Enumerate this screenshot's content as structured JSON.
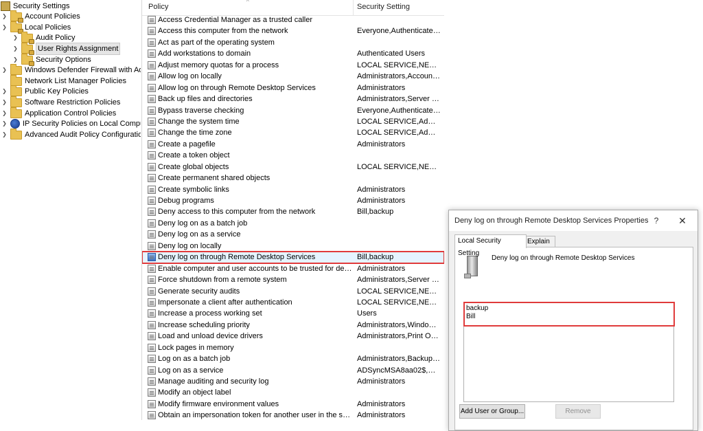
{
  "tree": {
    "items": [
      {
        "label": "Security Settings",
        "icon": "security-settings-icon"
      },
      {
        "label": "Account Policies",
        "icon": "folder-icon"
      },
      {
        "label": "Local Policies",
        "icon": "folder-icon"
      },
      {
        "label": "Audit Policy",
        "icon": "folder-icon"
      },
      {
        "label": "User Rights Assignment",
        "icon": "folder-icon"
      },
      {
        "label": "Security Options",
        "icon": "folder-icon"
      },
      {
        "label": "Windows Defender Firewall with Advar",
        "icon": "folder-icon"
      },
      {
        "label": "Network List Manager Policies",
        "icon": "folder-icon"
      },
      {
        "label": "Public Key Policies",
        "icon": "folder-icon"
      },
      {
        "label": "Software Restriction Policies",
        "icon": "folder-icon"
      },
      {
        "label": "Application Control Policies",
        "icon": "folder-icon"
      },
      {
        "label": "IP Security Policies on Local Computer",
        "icon": "ipsec-icon"
      },
      {
        "label": "Advanced Audit Policy Configuration",
        "icon": "folder-icon"
      }
    ]
  },
  "list": {
    "header_policy": "Policy",
    "header_setting": "Security Setting",
    "rows": [
      {
        "name": "Access Credential Manager as a trusted caller",
        "value": ""
      },
      {
        "name": "Access this computer from the network",
        "value": "Everyone,Authenticated ..."
      },
      {
        "name": "Act as part of the operating system",
        "value": ""
      },
      {
        "name": "Add workstations to domain",
        "value": "Authenticated Users"
      },
      {
        "name": "Adjust memory quotas for a process",
        "value": "LOCAL SERVICE,NETWOR..."
      },
      {
        "name": "Allow log on locally",
        "value": "Administrators,Account ..."
      },
      {
        "name": "Allow log on through Remote Desktop Services",
        "value": "Administrators"
      },
      {
        "name": "Back up files and directories",
        "value": "Administrators,Server Op..."
      },
      {
        "name": "Bypass traverse checking",
        "value": "Everyone,Authenticated ..."
      },
      {
        "name": "Change the system time",
        "value": "LOCAL SERVICE,Administr..."
      },
      {
        "name": "Change the time zone",
        "value": "LOCAL SERVICE,Administr..."
      },
      {
        "name": "Create a pagefile",
        "value": "Administrators"
      },
      {
        "name": "Create a token object",
        "value": ""
      },
      {
        "name": "Create global objects",
        "value": "LOCAL SERVICE,NETWOR..."
      },
      {
        "name": "Create permanent shared objects",
        "value": ""
      },
      {
        "name": "Create symbolic links",
        "value": "Administrators"
      },
      {
        "name": "Debug programs",
        "value": "Administrators"
      },
      {
        "name": "Deny access to this computer from the network",
        "value": "Bill,backup"
      },
      {
        "name": "Deny log on as a batch job",
        "value": ""
      },
      {
        "name": "Deny log on as a service",
        "value": ""
      },
      {
        "name": "Deny log on locally",
        "value": ""
      },
      {
        "name": "Deny log on through Remote Desktop Services",
        "value": "Bill,backup"
      },
      {
        "name": "Enable computer and user accounts to be trusted for delegati...",
        "value": "Administrators"
      },
      {
        "name": "Force shutdown from a remote system",
        "value": "Administrators,Server Op..."
      },
      {
        "name": "Generate security audits",
        "value": "LOCAL SERVICE,NETWOR..."
      },
      {
        "name": "Impersonate a client after authentication",
        "value": "LOCAL SERVICE,NETWOR..."
      },
      {
        "name": "Increase a process working set",
        "value": "Users"
      },
      {
        "name": "Increase scheduling priority",
        "value": "Administrators,Window ..."
      },
      {
        "name": "Load and unload device drivers",
        "value": "Administrators,Print Ope..."
      },
      {
        "name": "Lock pages in memory",
        "value": ""
      },
      {
        "name": "Log on as a batch job",
        "value": "Administrators,Backup O..."
      },
      {
        "name": "Log on as a service",
        "value": "ADSyncMSA8aa02$,NT S..."
      },
      {
        "name": "Manage auditing and security log",
        "value": "Administrators"
      },
      {
        "name": "Modify an object label",
        "value": ""
      },
      {
        "name": "Modify firmware environment values",
        "value": "Administrators"
      },
      {
        "name": "Obtain an impersonation token for another user in the same ...",
        "value": "Administrators"
      }
    ]
  },
  "dialog": {
    "title": "Deny log on through Remote Desktop Services Properties",
    "help": "?",
    "close": "✕",
    "tab_local": "Local Security Setting",
    "tab_explain": "Explain",
    "policy_title": "Deny log on through Remote Desktop Services",
    "members": [
      "backup",
      "Bill"
    ],
    "add_button": "Add User or Group...",
    "remove_button": "Remove"
  }
}
